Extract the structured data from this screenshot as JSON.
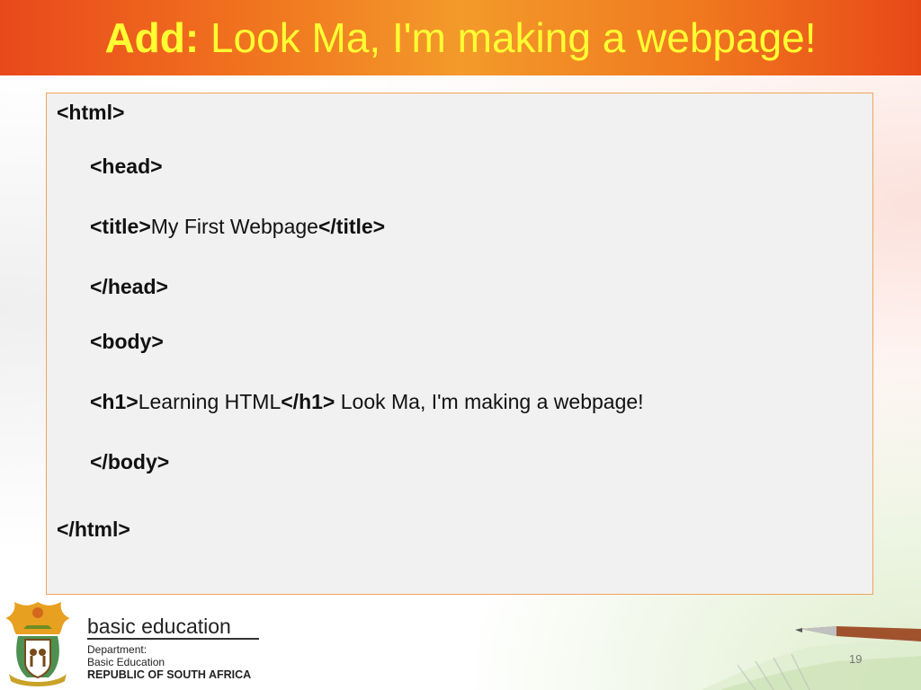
{
  "slide": {
    "title_bold": "Add:",
    "title_rest": " Look Ma, I'm making a webpage!",
    "page_number": "19"
  },
  "code": {
    "html_open": "<html>",
    "head_open": "<head>",
    "title_open": "<title>",
    "title_text": "My First Webpage",
    "title_close": "</title>",
    "head_close": "</head>",
    "body_open": "<body>",
    "h1_open": "<h1>",
    "h1_text": "Learning HTML",
    "h1_close": "</h1>",
    "after_h1": " Look Ma, I'm making a webpage!",
    "body_close": "</body>",
    "html_close": "</html>"
  },
  "logo": {
    "brand": "basic education",
    "dept_line1": "Department:",
    "dept_line2": "Basic Education",
    "dept_line3": "REPUBLIC OF SOUTH AFRICA"
  },
  "colors": {
    "title_text": "#ffff33",
    "title_bar": "#f0701e",
    "code_box_bg": "#f1f1f1",
    "code_box_border": "#f0a55a"
  }
}
